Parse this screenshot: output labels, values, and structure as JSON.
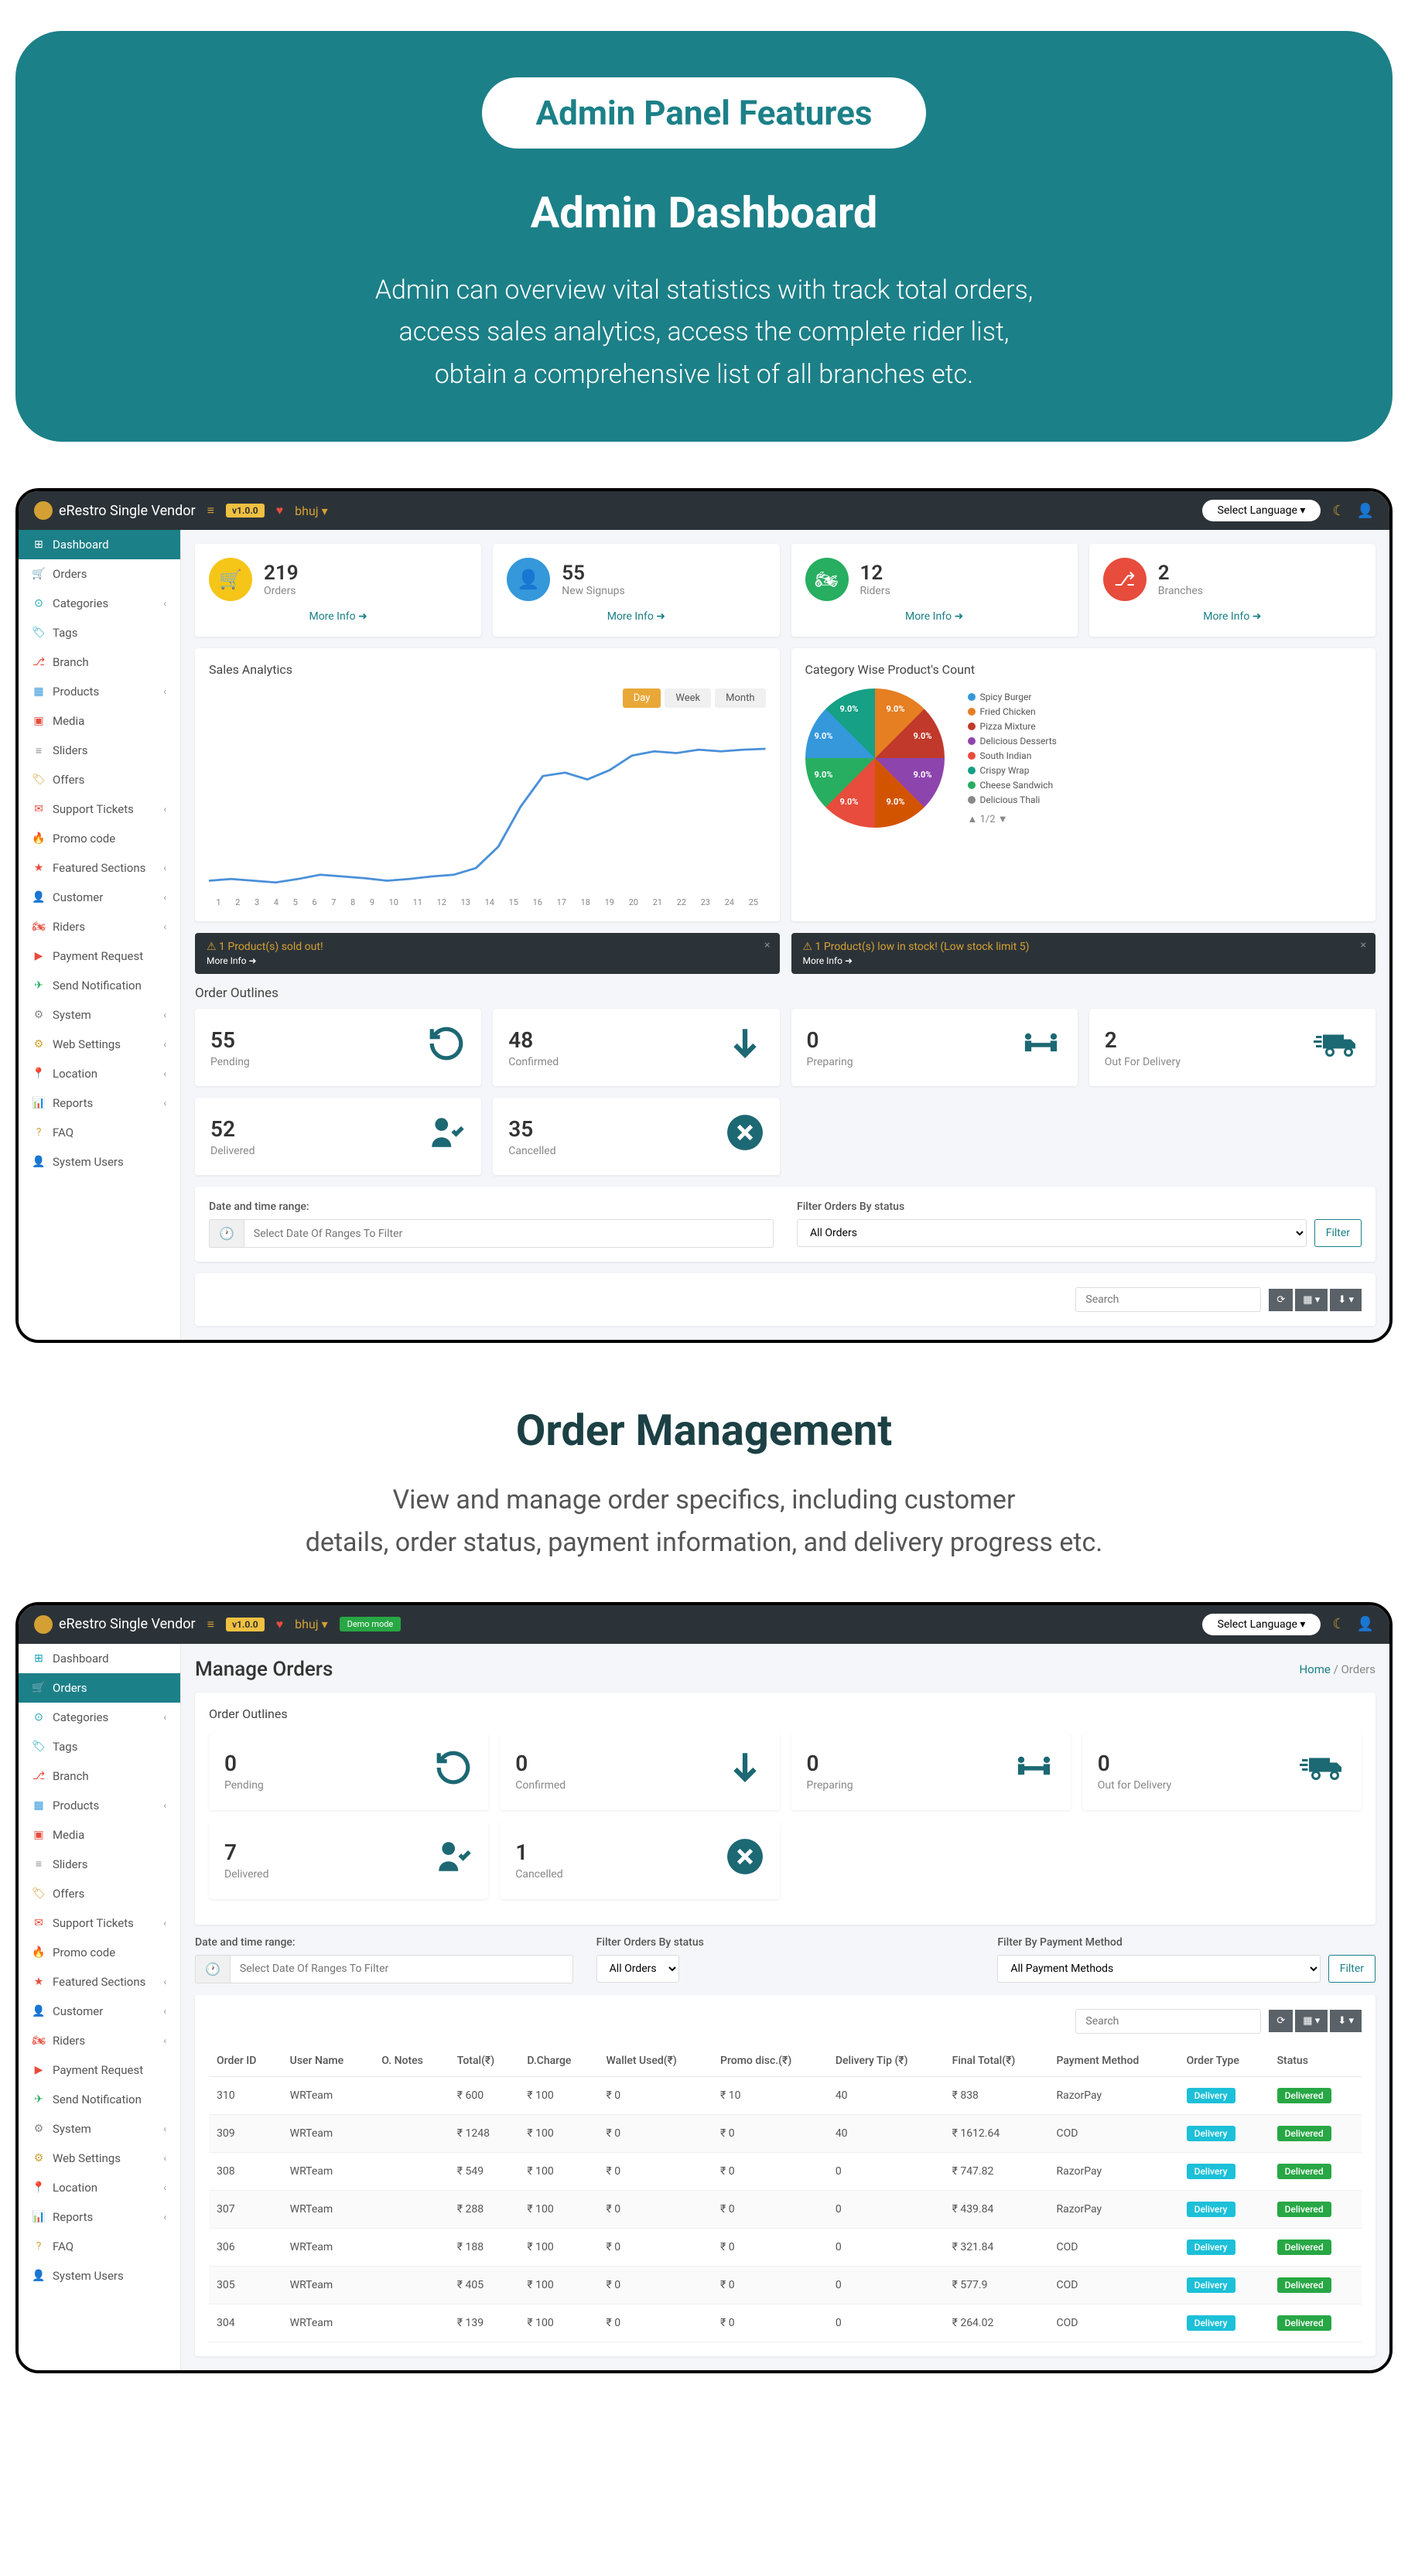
{
  "hero": {
    "pill": "Admin Panel Features",
    "title": "Admin Dashboard",
    "desc1": "Admin can overview vital statistics with track total orders,",
    "desc2": "access sales analytics, access the complete rider list,",
    "desc3": "obtain a comprehensive list of all branches etc."
  },
  "section2": {
    "title": "Order Management",
    "desc1": "View and manage order specifics, including customer",
    "desc2": "details, order status, payment information, and delivery progress etc."
  },
  "app": {
    "name": "eRestro Single Vendor",
    "version": "v1.0.0",
    "user": "bhuj",
    "demo": "Demo mode",
    "lang_label": "Select Language"
  },
  "sidebar": [
    {
      "label": "Dashboard",
      "icon": "⊞",
      "color": "#17a2b8"
    },
    {
      "label": "Orders",
      "icon": "🛒",
      "color": "#d4a033"
    },
    {
      "label": "Categories",
      "icon": "⊙",
      "color": "#17a2b8",
      "chev": true
    },
    {
      "label": "Tags",
      "icon": "🏷",
      "color": "#17a2b8"
    },
    {
      "label": "Branch",
      "icon": "⎇",
      "color": "#e74c3c"
    },
    {
      "label": "Products",
      "icon": "▦",
      "color": "#3498db",
      "chev": true
    },
    {
      "label": "Media",
      "icon": "▣",
      "color": "#e74c3c"
    },
    {
      "label": "Sliders",
      "icon": "≡",
      "color": "#888"
    },
    {
      "label": "Offers",
      "icon": "🏷",
      "color": "#d4a033"
    },
    {
      "label": "Support Tickets",
      "icon": "✉",
      "color": "#e74c3c",
      "chev": true
    },
    {
      "label": "Promo code",
      "icon": "🔥",
      "color": "#d4a033"
    },
    {
      "label": "Featured Sections",
      "icon": "★",
      "color": "#e74c3c",
      "chev": true
    },
    {
      "label": "Customer",
      "icon": "👤",
      "color": "#27ae60",
      "chev": true
    },
    {
      "label": "Riders",
      "icon": "🏍",
      "color": "#e74c3c",
      "chev": true
    },
    {
      "label": "Payment Request",
      "icon": "▶",
      "color": "#e74c3c"
    },
    {
      "label": "Send Notification",
      "icon": "✈",
      "color": "#27ae60"
    },
    {
      "label": "System",
      "icon": "⚙",
      "color": "#888",
      "chev": true
    },
    {
      "label": "Web Settings",
      "icon": "⚙",
      "color": "#d4a033",
      "chev": true
    },
    {
      "label": "Location",
      "icon": "📍",
      "color": "#e74c3c",
      "chev": true
    },
    {
      "label": "Reports",
      "icon": "📊",
      "color": "#e74c3c",
      "chev": true
    },
    {
      "label": "FAQ",
      "icon": "?",
      "color": "#d4a033"
    },
    {
      "label": "System Users",
      "icon": "👤",
      "color": "#e74c3c"
    }
  ],
  "stats": [
    {
      "num": "219",
      "label": "Orders",
      "more": "More Info"
    },
    {
      "num": "55",
      "label": "New Signups",
      "more": "More Info"
    },
    {
      "num": "12",
      "label": "Riders",
      "more": "More Info"
    },
    {
      "num": "2",
      "label": "Branches",
      "more": "More Info"
    }
  ],
  "sales": {
    "title": "Sales Analytics",
    "btns": [
      "Day",
      "Week",
      "Month"
    ],
    "x_ticks": [
      "1",
      "2",
      "3",
      "4",
      "5",
      "6",
      "7",
      "8",
      "9",
      "10",
      "11",
      "12",
      "13",
      "14",
      "15",
      "16",
      "17",
      "18",
      "19",
      "20",
      "21",
      "22",
      "23",
      "24",
      "25"
    ]
  },
  "pie_card": {
    "title": "Category Wise Product's Count",
    "slice_label": "9.0%",
    "legend": [
      {
        "name": "Spicy Burger",
        "color": "#3498db"
      },
      {
        "name": "Fried Chicken",
        "color": "#e67e22"
      },
      {
        "name": "Pizza Mixture",
        "color": "#c0392b"
      },
      {
        "name": "Delicious Desserts",
        "color": "#8e44ad"
      },
      {
        "name": "South Indian",
        "color": "#e74c3c"
      },
      {
        "name": "Crispy Wrap",
        "color": "#16a085"
      },
      {
        "name": "Cheese Sandwich",
        "color": "#27ae60"
      },
      {
        "name": "Delicious Thali",
        "color": "#888"
      }
    ],
    "ctrl": "1/2"
  },
  "alerts": [
    {
      "txt": "1 Product(s) sold out!",
      "mi": "More Info"
    },
    {
      "txt": "1 Product(s) low in stock! (Low stock limit 5)",
      "mi": "More Info"
    }
  ],
  "outlines_title": "Order Outlines",
  "outlines": [
    {
      "num": "55",
      "label": "Pending",
      "icon": "↺"
    },
    {
      "num": "48",
      "label": "Confirmed",
      "icon": "↓"
    },
    {
      "num": "0",
      "label": "Preparing",
      "icon": "👥"
    },
    {
      "num": "2",
      "label": "Out For Delivery",
      "icon": "🚚"
    },
    {
      "num": "52",
      "label": "Delivered",
      "icon": "✓"
    },
    {
      "num": "35",
      "label": "Cancelled",
      "icon": "✕"
    }
  ],
  "filters": {
    "date_label": "Date and time range:",
    "date_placeholder": "Select Date Of Ranges To Filter",
    "status_label": "Filter Orders By status",
    "status_value": "All Orders",
    "filter_btn": "Filter",
    "search_placeholder": "Search"
  },
  "orders_page": {
    "title": "Manage Orders",
    "home": "Home",
    "crumb_current": "Orders",
    "outlines": [
      {
        "num": "0",
        "label": "Pending",
        "icon": "↺"
      },
      {
        "num": "0",
        "label": "Confirmed",
        "icon": "↓"
      },
      {
        "num": "0",
        "label": "Preparing",
        "icon": "👥"
      },
      {
        "num": "0",
        "label": "Out for Delivery",
        "icon": "🚚"
      },
      {
        "num": "7",
        "label": "Delivered",
        "icon": "✓"
      },
      {
        "num": "1",
        "label": "Cancelled",
        "icon": "✕"
      }
    ],
    "filters": {
      "date_label": "Date and time range:",
      "date_placeholder": "Select Date Of Ranges To Filter",
      "status_label": "Filter Orders By status",
      "status_value": "All Orders",
      "payment_label": "Filter By Payment Method",
      "payment_value": "All Payment Methods",
      "filter_btn": "Filter",
      "search_placeholder": "Search"
    },
    "columns": [
      "Order ID",
      "User Name",
      "O. Notes",
      "Total(₹)",
      "D.Charge",
      "Wallet Used(₹)",
      "Promo disc.(₹)",
      "Delivery Tip (₹)",
      "Final Total(₹)",
      "Payment Method",
      "Order Type",
      "Status"
    ],
    "rows": [
      {
        "id": "310",
        "user": "WRTeam",
        "notes": "",
        "total": "₹ 600",
        "dc": "₹ 100",
        "wallet": "₹ 0",
        "promo": "₹ 10",
        "tip": "40",
        "final": "₹ 838",
        "pm": "RazorPay",
        "otype": "Delivery",
        "status": "Delivered"
      },
      {
        "id": "309",
        "user": "WRTeam",
        "notes": "",
        "total": "₹ 1248",
        "dc": "₹ 100",
        "wallet": "₹ 0",
        "promo": "₹ 0",
        "tip": "40",
        "final": "₹ 1612.64",
        "pm": "COD",
        "otype": "Delivery",
        "status": "Delivered"
      },
      {
        "id": "308",
        "user": "WRTeam",
        "notes": "",
        "total": "₹ 549",
        "dc": "₹ 100",
        "wallet": "₹ 0",
        "promo": "₹ 0",
        "tip": "0",
        "final": "₹ 747.82",
        "pm": "RazorPay",
        "otype": "Delivery",
        "status": "Delivered"
      },
      {
        "id": "307",
        "user": "WRTeam",
        "notes": "",
        "total": "₹ 288",
        "dc": "₹ 100",
        "wallet": "₹ 0",
        "promo": "₹ 0",
        "tip": "0",
        "final": "₹ 439.84",
        "pm": "RazorPay",
        "otype": "Delivery",
        "status": "Delivered"
      },
      {
        "id": "306",
        "user": "WRTeam",
        "notes": "",
        "total": "₹ 188",
        "dc": "₹ 100",
        "wallet": "₹ 0",
        "promo": "₹ 0",
        "tip": "0",
        "final": "₹ 321.84",
        "pm": "COD",
        "otype": "Delivery",
        "status": "Delivered"
      },
      {
        "id": "305",
        "user": "WRTeam",
        "notes": "",
        "total": "₹ 405",
        "dc": "₹ 100",
        "wallet": "₹ 0",
        "promo": "₹ 0",
        "tip": "0",
        "final": "₹ 577.9",
        "pm": "COD",
        "otype": "Delivery",
        "status": "Delivered"
      },
      {
        "id": "304",
        "user": "WRTeam",
        "notes": "",
        "total": "₹ 139",
        "dc": "₹ 100",
        "wallet": "₹ 0",
        "promo": "₹ 0",
        "tip": "0",
        "final": "₹ 264.02",
        "pm": "COD",
        "otype": "Delivery",
        "status": "Delivered"
      }
    ]
  },
  "chart_data": {
    "type": "line",
    "title": "Sales Analytics",
    "xlabel": "Day",
    "ylabel": "",
    "x": [
      1,
      2,
      3,
      4,
      5,
      6,
      7,
      8,
      9,
      10,
      11,
      12,
      13,
      14,
      15,
      16,
      17,
      18,
      19,
      20,
      21,
      22,
      23,
      24,
      25
    ],
    "values": [
      5,
      6,
      5,
      4,
      6,
      8,
      7,
      6,
      5,
      6,
      7,
      8,
      12,
      25,
      50,
      70,
      72,
      68,
      74,
      82,
      85,
      84,
      86,
      85,
      86
    ]
  }
}
